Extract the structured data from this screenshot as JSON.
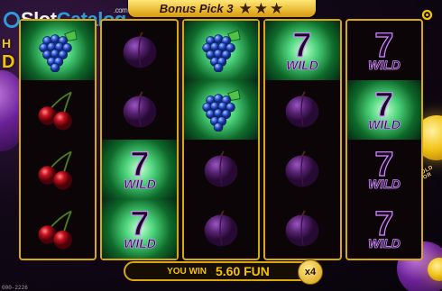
{
  "brand": {
    "logo_part1": "Slot",
    "logo_part2": "Catalog",
    "logo_suffix": ".com"
  },
  "header": {
    "title": "Bonus Pick 3",
    "stars_count": 3
  },
  "left_edge_text": {
    "line1": "H",
    "line2": "D"
  },
  "right_button_text": "HOLD FOR",
  "reels": [
    [
      "grape",
      "plum",
      "plum",
      "plum",
      "plum"
    ],
    [
      "cherry",
      "plum",
      "wild",
      "wild",
      "wild"
    ],
    [
      "cherry",
      "wild",
      "plum",
      "plum",
      "wild"
    ],
    [
      "cherry",
      "wild",
      "plum",
      "plum",
      "wild"
    ]
  ],
  "reels_by_column": [
    [
      "grape",
      "cherry",
      "cherry",
      "cherry"
    ],
    [
      "plum",
      "plum",
      "wild",
      "wild"
    ],
    [
      "grape",
      "grape",
      "plum",
      "plum"
    ],
    [
      "wild",
      "plum",
      "plum",
      "plum"
    ],
    [
      "wild",
      "wild",
      "wild",
      "wild"
    ]
  ],
  "glow_by_column": [
    [
      true,
      false,
      false,
      false
    ],
    [
      false,
      false,
      true,
      true
    ],
    [
      true,
      true,
      false,
      false
    ],
    [
      true,
      false,
      false,
      false
    ],
    [
      false,
      true,
      false,
      false
    ]
  ],
  "wild_label": "WILD",
  "wild_number": "7",
  "win": {
    "label": "YOU WIN",
    "amount": "5.60 FUN",
    "multiplier": "x4"
  },
  "footer": "000-2226",
  "colors": {
    "gold": "#d9a80f",
    "green_glow": "#4bd37a",
    "plum": "#5a2470",
    "cherry": "#b3101c",
    "grape": "#2b5bd9"
  }
}
